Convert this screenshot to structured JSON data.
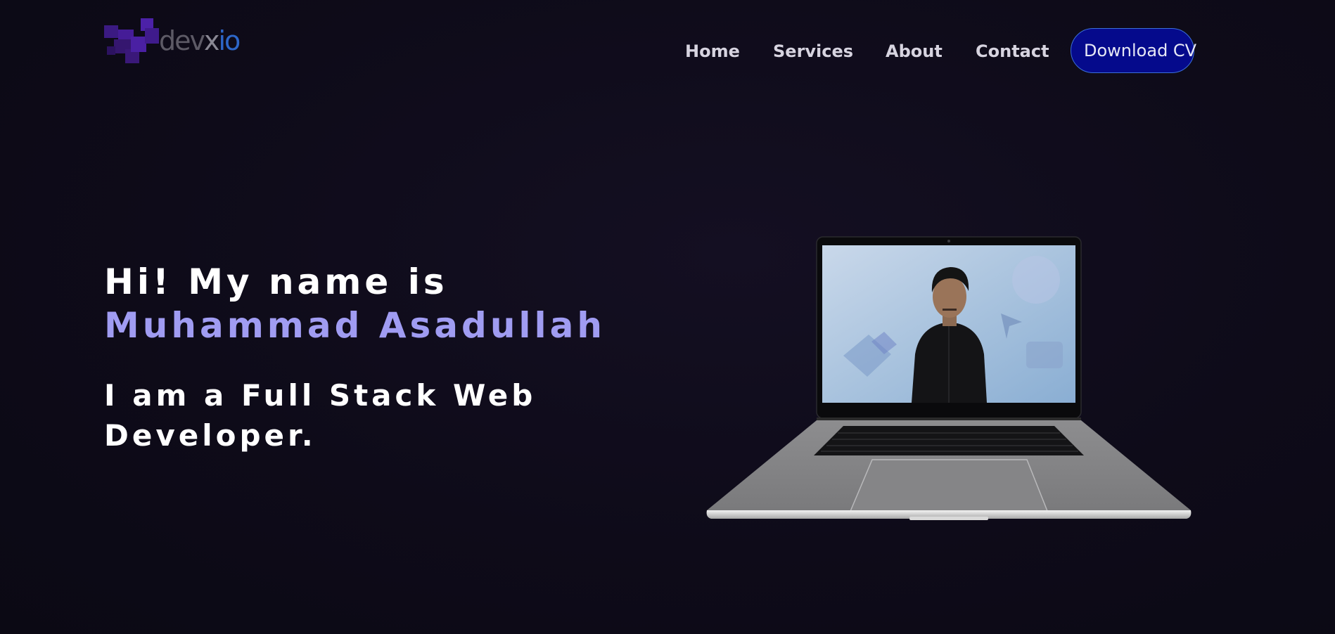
{
  "header": {
    "logo": {
      "icon": "pixel-blocks-logo-mark",
      "part_dev": "dev",
      "part_x": "x",
      "part_io": "io"
    },
    "nav": [
      {
        "label": "Home"
      },
      {
        "label": "Services"
      },
      {
        "label": "About"
      },
      {
        "label": "Contact"
      }
    ],
    "cta_label": "Download CV"
  },
  "hero": {
    "intro": "Hi! My name is",
    "name": "Muhammad Asadullah",
    "tagline": "I am a Full Stack Web Developer."
  },
  "illustration": {
    "icon": "laptop-with-portrait-photo"
  },
  "colors": {
    "background": "#0d0a17",
    "accent_name": "#a09cf2",
    "cta_background": "#050a8c",
    "cta_border": "#3c6fd8",
    "nav_text": "#d7d4e0"
  }
}
